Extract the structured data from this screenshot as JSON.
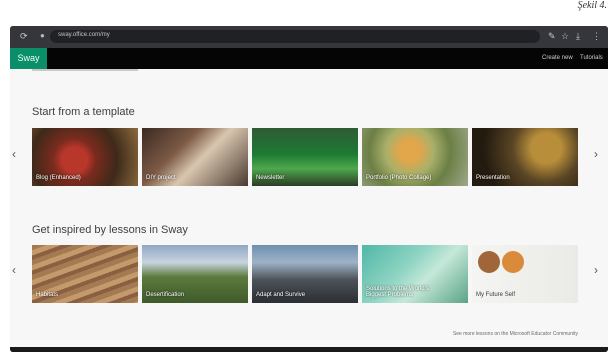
{
  "caption": "Şekil 4.",
  "browser": {
    "url": "sway.office.com/my",
    "icons": [
      "reload-icon",
      "lock-icon",
      "extensions-icon",
      "star-icon",
      "download-icon",
      "menu-icon"
    ]
  },
  "header": {
    "logo": "Sway",
    "create_new": "Create new",
    "tutorials": "Tutorials"
  },
  "templates": {
    "title": "Start from a template",
    "cards": [
      {
        "label": "Blog (Enhanced)"
      },
      {
        "label": "DIY project"
      },
      {
        "label": "Newsletter"
      },
      {
        "label": "Portfolio (Photo Collage)"
      },
      {
        "label": "Presentation"
      }
    ]
  },
  "lessons": {
    "title": "Get inspired by lessons in Sway",
    "cards": [
      {
        "label": "Habitats"
      },
      {
        "label": "Desertification"
      },
      {
        "label": "Adapt and Survive"
      },
      {
        "label": "Solutions to the World's Biggest Problems"
      },
      {
        "label": "My Future Self"
      }
    ],
    "more_link": "See more lessons on the Microsoft Educator Community"
  },
  "nav": {
    "prev": "‹",
    "next": "›"
  },
  "colors": {
    "sway_green": "#0b8f6a",
    "header_bg": "#050505",
    "content_bg": "#f7f7f7"
  }
}
